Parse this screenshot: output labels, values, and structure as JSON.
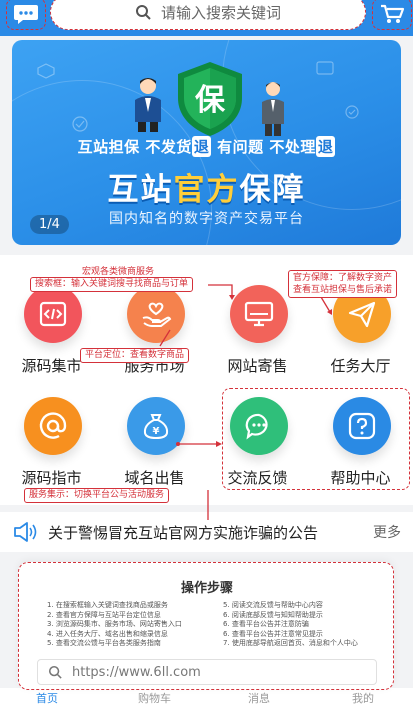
{
  "header": {
    "search_placeholder": "请输入搜索关键词",
    "icons": [
      "chat-icon",
      "search-icon",
      "cart-icon"
    ]
  },
  "banner": {
    "shield_char": "保",
    "subtitle_parts": [
      "互站担保 不发货",
      "退",
      " 有问题 不处理",
      "退"
    ],
    "title_parts": [
      "互站",
      "官方",
      "保障"
    ],
    "description": "国内知名的数字资产交易平台",
    "pager": "1/4"
  },
  "grid": {
    "items": [
      {
        "label": "源码集市",
        "icon": "code-icon",
        "color": "#f2555c"
      },
      {
        "label": "服务市场",
        "icon": "heart-hand-icon",
        "color": "#f5824d"
      },
      {
        "label": "网站寄售",
        "icon": "monitor-icon",
        "color": "#f2635a"
      },
      {
        "label": "任务大厅",
        "icon": "paper-plane-icon",
        "color": "#f7a02a"
      },
      {
        "label": "源码指市",
        "icon": "at-icon",
        "color": "#f7901f"
      },
      {
        "label": "域名出售",
        "icon": "money-bag-icon",
        "color": "#3a9ae8"
      },
      {
        "label": "交流反馈",
        "icon": "chat-bubble-icon",
        "color": "#2fbf7a"
      },
      {
        "label": "帮助中心",
        "icon": "help-icon",
        "color": "#2a8ae4"
      }
    ]
  },
  "annotations": {
    "search_box": "搜索框：输入关键词搜寻找商品与订单",
    "overview": "宏观各类微商服务",
    "official": "官方保障：了解数字资产",
    "official_2": "查看互站担保与售后承诺",
    "positioning": "平台定位：查看数字商品",
    "quick_nav": "服务集示：切换平台公与活动服务"
  },
  "notice": {
    "text": "关于警惕冒充互站官网方实施诈骗的公告",
    "more": "更多"
  },
  "steps": {
    "title": "操作步骤",
    "left": [
      "1. 在搜索框输入关键词查找商品或服务",
      "2. 查看官方保障与互站平台定位信息",
      "3. 浏览源码集市、服务市场、网站寄售入口",
      "4. 进入任务大厅、域名出售和缩录信息",
      "5. 查看交流公馈与平台各类服务指南"
    ],
    "right": [
      "5. 阅读交流反馈与帮助中心内容",
      "6. 阅读底部反馈与知知帮助提示",
      "6. 查看平台公告并注意防骗",
      "6. 查看平台公告并注意常见提示",
      "7. 使用底部导航返回首页、消息和个人中心"
    ],
    "url": "https://www.6ll.com"
  },
  "tabbar": {
    "tabs": [
      "首页",
      "购物车",
      "消息",
      "我的"
    ]
  },
  "colors": {
    "brand_blue": "#2b8ae6",
    "annotation_red": "#d4313a"
  }
}
